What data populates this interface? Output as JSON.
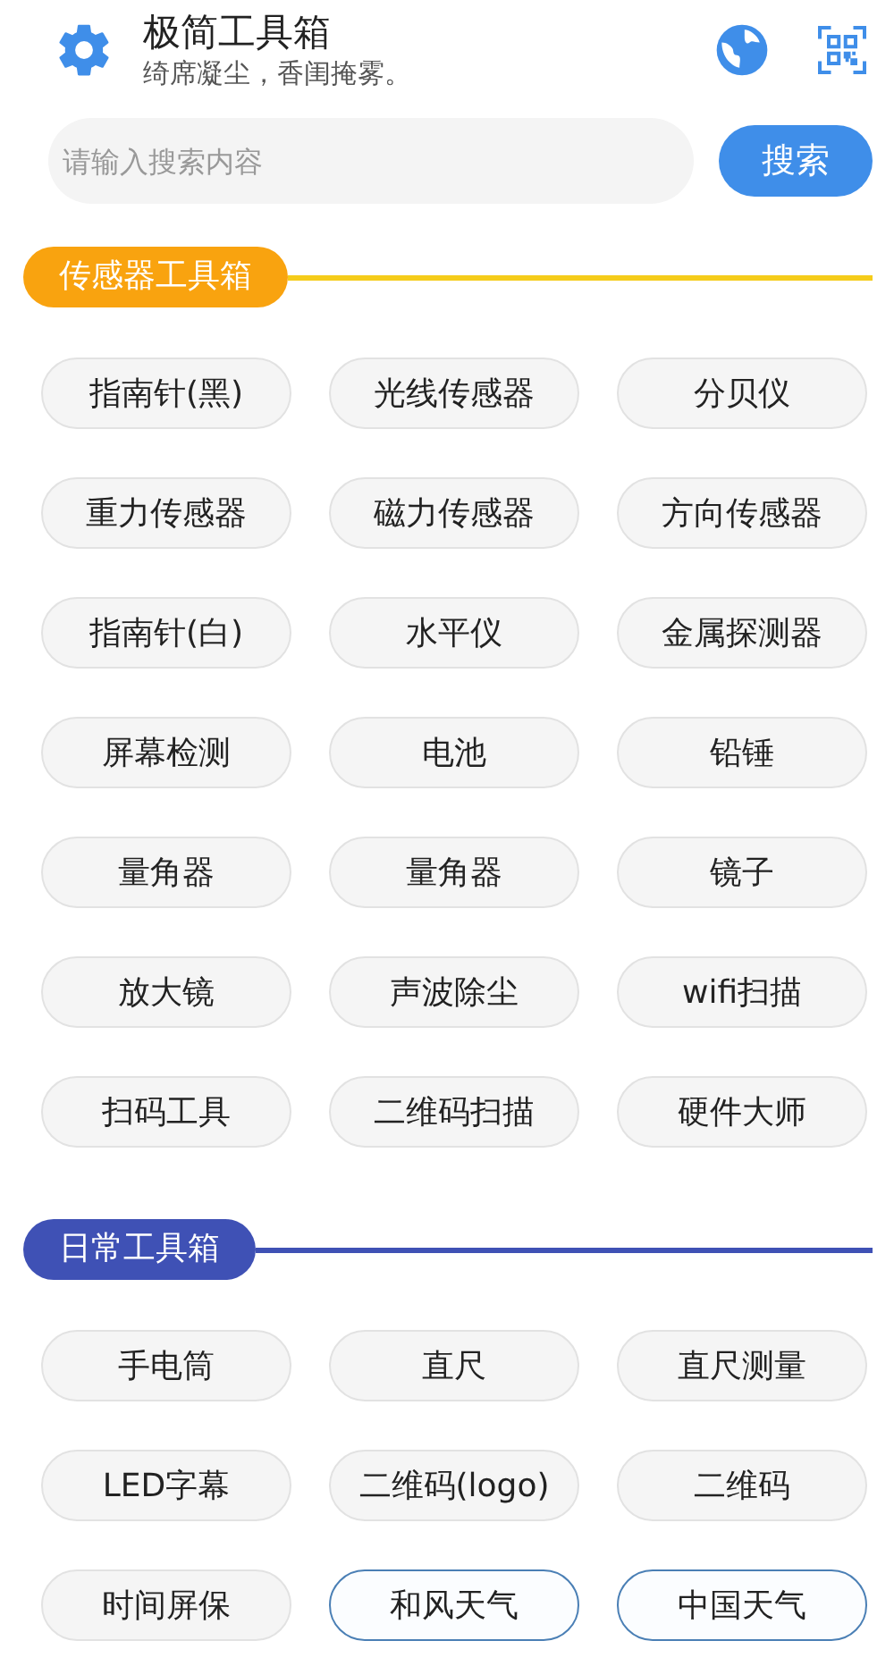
{
  "header": {
    "title": "极简工具箱",
    "subtitle": "绮席凝尘，香闺掩雾。"
  },
  "search": {
    "placeholder": "请输入搜索内容",
    "button": "搜索"
  },
  "sections": [
    {
      "title": "传感器工具箱",
      "color": "#f9a30f",
      "tools": [
        {
          "label": "指南针(黑)",
          "kind": "plain"
        },
        {
          "label": "光线传感器",
          "kind": "plain"
        },
        {
          "label": "分贝仪",
          "kind": "plain"
        },
        {
          "label": "重力传感器",
          "kind": "plain"
        },
        {
          "label": "磁力传感器",
          "kind": "plain"
        },
        {
          "label": "方向传感器",
          "kind": "plain"
        },
        {
          "label": "指南针(白)",
          "kind": "plain"
        },
        {
          "label": "水平仪",
          "kind": "plain"
        },
        {
          "label": "金属探测器",
          "kind": "plain"
        },
        {
          "label": "屏幕检测",
          "kind": "plain"
        },
        {
          "label": "电池",
          "kind": "plain"
        },
        {
          "label": "铅锤",
          "kind": "plain"
        },
        {
          "label": "量角器",
          "kind": "plain"
        },
        {
          "label": "量角器",
          "kind": "plain"
        },
        {
          "label": "镜子",
          "kind": "plain"
        },
        {
          "label": "放大镜",
          "kind": "plain"
        },
        {
          "label": "声波除尘",
          "kind": "plain"
        },
        {
          "label": "wifi扫描",
          "kind": "plain"
        },
        {
          "label": "扫码工具",
          "kind": "plain"
        },
        {
          "label": "二维码扫描",
          "kind": "plain"
        },
        {
          "label": "硬件大师",
          "kind": "plain"
        }
      ]
    },
    {
      "title": "日常工具箱",
      "color": "#3f51b5",
      "tools": [
        {
          "label": "手电筒",
          "kind": "plain"
        },
        {
          "label": "直尺",
          "kind": "plain"
        },
        {
          "label": "直尺测量",
          "kind": "plain"
        },
        {
          "label": "LED字幕",
          "kind": "plain"
        },
        {
          "label": "二维码(logo)",
          "kind": "plain"
        },
        {
          "label": "二维码",
          "kind": "plain"
        },
        {
          "label": "时间屏保",
          "kind": "plain"
        },
        {
          "label": "和风天气",
          "kind": "outlined"
        },
        {
          "label": "中国天气",
          "kind": "outlined"
        }
      ]
    }
  ]
}
